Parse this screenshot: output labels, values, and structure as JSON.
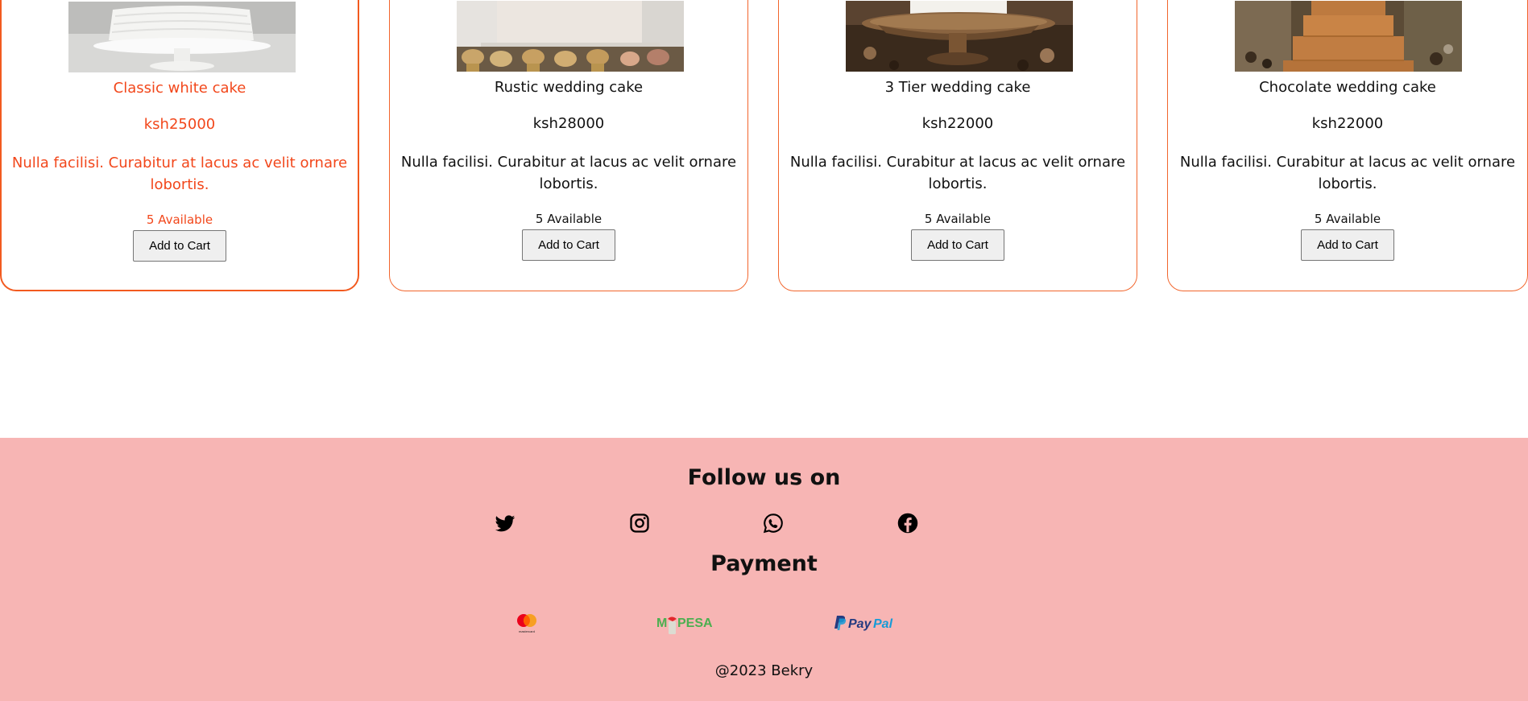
{
  "products": [
    {
      "name": "Classic white cake",
      "price": "ksh25000",
      "description": "Nulla facilisi. Curabitur at lacus ac velit ornare lobortis.",
      "availability": "5 Available",
      "button_label": "Add to Cart"
    },
    {
      "name": "Rustic wedding cake",
      "price": "ksh28000",
      "description": "Nulla facilisi. Curabitur at lacus ac velit ornare lobortis.",
      "availability": "5 Available",
      "button_label": "Add to Cart"
    },
    {
      "name": "3 Tier wedding cake",
      "price": "ksh22000",
      "description": "Nulla facilisi. Curabitur at lacus ac velit ornare lobortis.",
      "availability": "5 Available",
      "button_label": "Add to Cart"
    },
    {
      "name": "Chocolate wedding cake",
      "price": "ksh22000",
      "description": "Nulla facilisi. Curabitur at lacus ac velit ornare lobortis.",
      "availability": "5 Available",
      "button_label": "Add to Cart"
    }
  ],
  "footer": {
    "follow_title": "Follow us on",
    "social_icons": [
      "twitter-icon",
      "instagram-icon",
      "whatsapp-icon",
      "facebook-icon"
    ],
    "payment_title": "Payment",
    "payment_methods": {
      "mastercard_caption": "mastercard",
      "mpesa": {
        "prefix": "M",
        "suffix": "PESA"
      },
      "paypal": {
        "pay": "Pay",
        "pal": "Pal"
      }
    },
    "copyright": "@2023 Bekry"
  },
  "colors": {
    "accent": "#f2652c",
    "active_text": "#f2471b",
    "footer_bg": "#f7b5b4",
    "mpesa_green": "#4caf50",
    "mpesa_red": "#e3262c",
    "paypal_dark": "#253b80",
    "paypal_light": "#179bd7",
    "mastercard_red": "#eb001b",
    "mastercard_orange": "#f79e1b"
  }
}
